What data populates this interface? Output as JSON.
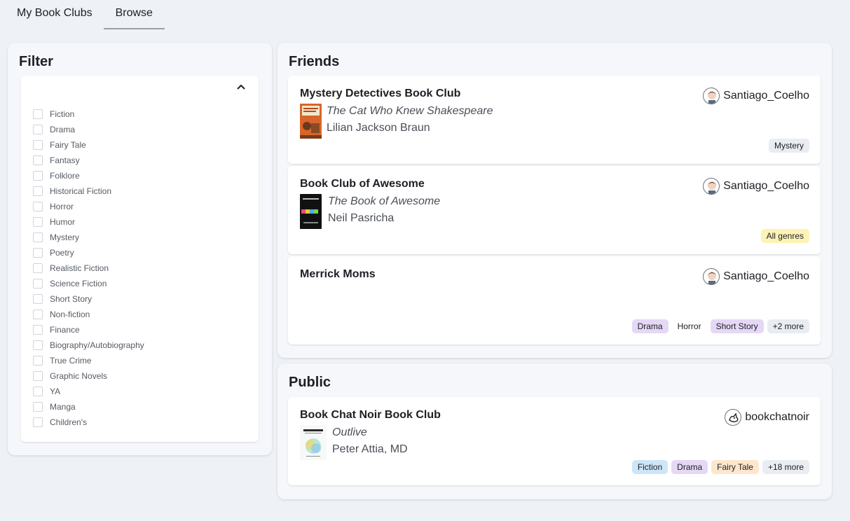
{
  "tabs": [
    {
      "label": "My Book Clubs",
      "active": false
    },
    {
      "label": "Browse",
      "active": true
    }
  ],
  "filter": {
    "title": "Filter",
    "genres": [
      "Fiction",
      "Drama",
      "Fairy Tale",
      "Fantasy",
      "Folklore",
      "Historical Fiction",
      "Horror",
      "Humor",
      "Mystery",
      "Poetry",
      "Realistic Fiction",
      "Science Fiction",
      "Short Story",
      "Non-fiction",
      "Finance",
      "Biography/Autobiography",
      "True Crime",
      "Graphic Novels",
      "YA",
      "Manga",
      "Children's"
    ]
  },
  "friends": {
    "title": "Friends",
    "clubs": [
      {
        "name": "Mystery Detectives Book Club",
        "book_title": "The Cat Who Knew Shakespeare",
        "book_author": "Lilian Jackson Braun",
        "owner": "Santiago_Coelho",
        "tags": [
          {
            "label": "Mystery",
            "color": "#e9ecf0"
          }
        ]
      },
      {
        "name": "Book Club of Awesome",
        "book_title": "The Book of Awesome",
        "book_author": "Neil Pasricha",
        "owner": "Santiago_Coelho",
        "tags": [
          {
            "label": "All genres",
            "color": "#fdf3b5"
          }
        ]
      },
      {
        "name": "Merrick Moms",
        "owner": "Santiago_Coelho",
        "tags": [
          {
            "label": "Drama",
            "color": "#e5d8f5"
          },
          {
            "label": "Horror",
            "color": "#ffffff"
          },
          {
            "label": "Short Story",
            "color": "#e5d8f5"
          },
          {
            "label": "+2 more",
            "color": "#e9ecf0"
          }
        ]
      }
    ]
  },
  "public": {
    "title": "Public",
    "clubs": [
      {
        "name": "Book Chat Noir Book Club",
        "book_title": "Outlive",
        "book_author": "Peter Attia, MD",
        "owner": "bookchatnoir",
        "tags": [
          {
            "label": "Fiction",
            "color": "#cde6f7"
          },
          {
            "label": "Drama",
            "color": "#e5d8f5"
          },
          {
            "label": "Fairy Tale",
            "color": "#fde6cc"
          },
          {
            "label": "+18 more",
            "color": "#e9ecf0"
          }
        ]
      }
    ]
  }
}
